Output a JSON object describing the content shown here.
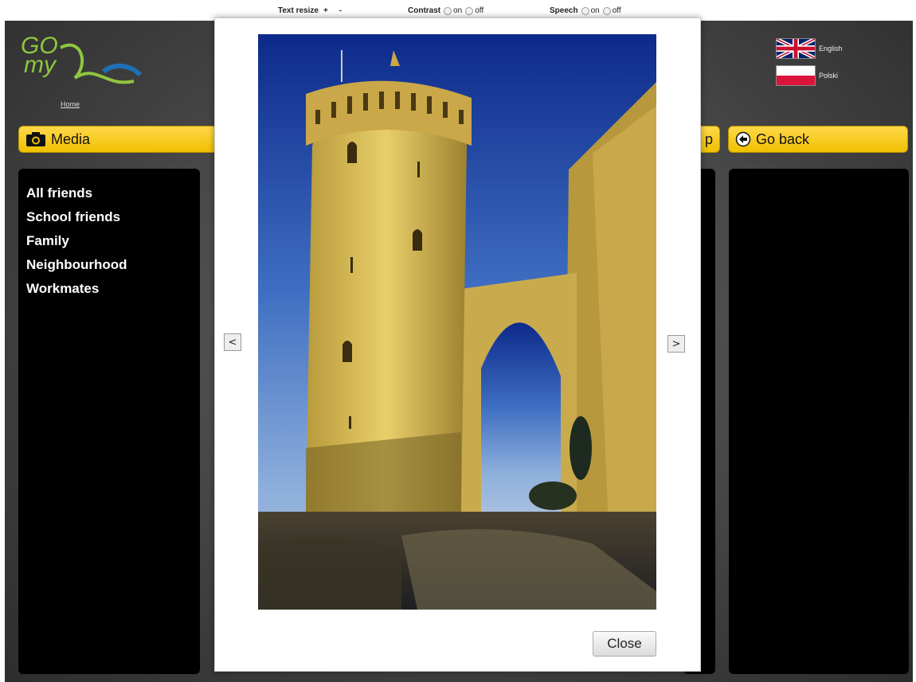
{
  "toolbar": {
    "text_resize_label": "Text resize",
    "increase_label": "+",
    "decrease_label": "-",
    "contrast_label": "Contrast",
    "speech_label": "Speech",
    "on_label": "on",
    "off_label": "off"
  },
  "header": {
    "logo_line1": "GO",
    "logo_line2": "my",
    "home_link": "Home"
  },
  "languages": [
    {
      "label": "English",
      "flag": "uk-flag-icon"
    },
    {
      "label": "Polski",
      "flag": "poland-flag-icon"
    }
  ],
  "media_section": {
    "title": "Media",
    "icon": "camera-icon"
  },
  "hidden_section": {
    "title_fragment": "p"
  },
  "back_section": {
    "title": "Go back",
    "icon": "back-arrow-icon"
  },
  "friends": [
    "All friends",
    "School friends",
    "Family",
    "Neighbourhood",
    "Workmates"
  ],
  "lightbox": {
    "prev_label": "<",
    "next_label": ">",
    "close_label": "Close"
  },
  "colors": {
    "accent_yellow": "#f0c000",
    "logo_green": "#8ec63f",
    "logo_blue": "#1f6fb5",
    "panel_black": "#000000"
  }
}
